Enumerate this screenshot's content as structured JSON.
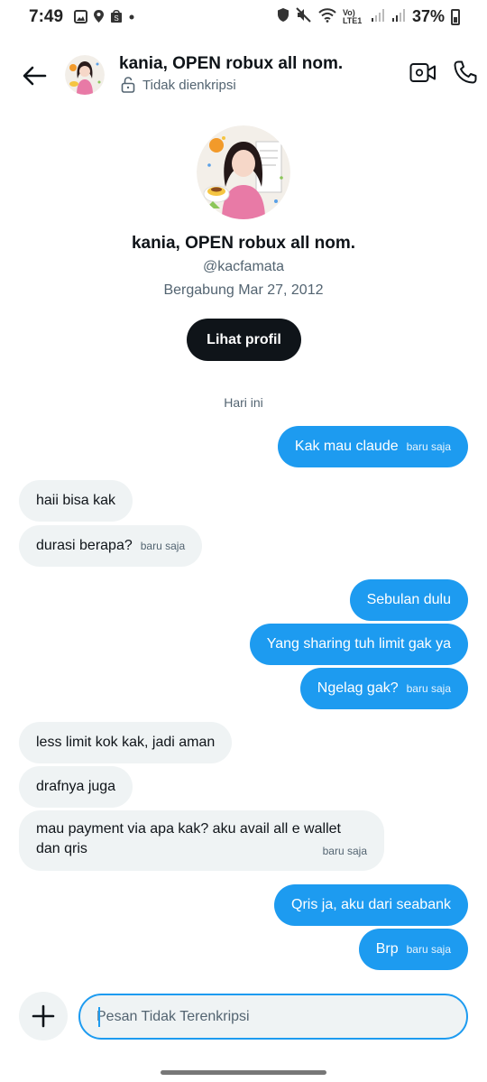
{
  "status_bar": {
    "time": "7:49",
    "battery": "37%",
    "network": "Vo) LTE1",
    "left_icons": [
      "image-icon",
      "location-icon",
      "shopping-bag-icon",
      "dot-icon"
    ],
    "right_icons": [
      "shield-icon",
      "mute-icon",
      "wifi-icon",
      "signal-icon",
      "signal-icon",
      "battery-icon"
    ]
  },
  "header": {
    "title": "kania, OPEN robux all nom.",
    "encryption": "Tidak dienkripsi"
  },
  "profile": {
    "name": "kania, OPEN robux all nom.",
    "handle": "@kacfamata",
    "joined": "Bergabung Mar 27, 2012",
    "button": "Lihat profil"
  },
  "day_separator": "Hari ini",
  "messages": [
    {
      "dir": "out",
      "text": "Kak mau claude",
      "time": "baru saja"
    },
    {
      "dir": "in",
      "text": "haii bisa kak",
      "time": ""
    },
    {
      "dir": "in",
      "text": "durasi berapa?",
      "time": "baru saja"
    },
    {
      "dir": "out",
      "text": "Sebulan dulu",
      "time": ""
    },
    {
      "dir": "out",
      "text": "Yang sharing tuh limit gak ya",
      "time": ""
    },
    {
      "dir": "out",
      "text": "Ngelag gak?",
      "time": "baru saja"
    },
    {
      "dir": "in",
      "text": "less limit kok kak, jadi aman",
      "time": ""
    },
    {
      "dir": "in",
      "text": "drafnya juga",
      "time": ""
    },
    {
      "dir": "in",
      "text": "mau payment via apa kak? aku avail all e wallet dan qris",
      "time": "baru saja"
    },
    {
      "dir": "out",
      "text": "Qris ja, aku dari seabank",
      "time": ""
    },
    {
      "dir": "out",
      "text": "Brp",
      "time": "baru saja"
    }
  ],
  "composer": {
    "placeholder": "Pesan Tidak Terenkripsi",
    "value": ""
  },
  "colors": {
    "accent": "#1d9bf0",
    "incoming_bubble": "#eff3f4",
    "primary_text": "#0f1419",
    "secondary_text": "#536471",
    "button_dark": "#0f1419"
  }
}
